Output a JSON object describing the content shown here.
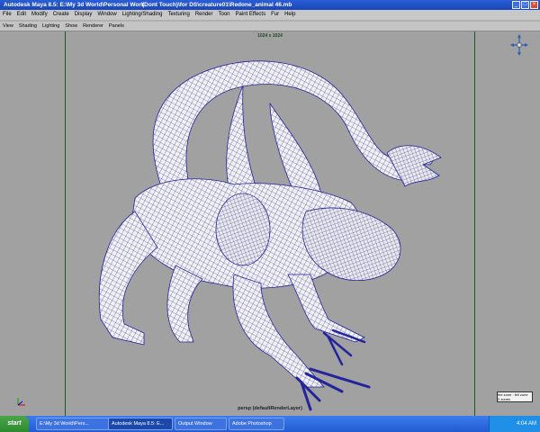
{
  "window": {
    "title": "Autodesk Maya 8.5: E:\\My 3d World\\Personal Work",
    "document": "(Dont Touch)\\for DS\\creature01\\Redone_animal 46.mb"
  },
  "menu": [
    "File",
    "Edit",
    "Modify",
    "Create",
    "Display",
    "Window",
    "Lighting/Shading",
    "Texturing",
    "Render",
    "Toon",
    "Paint Effects",
    "Fur",
    "Help"
  ],
  "panel_menu": [
    "View",
    "Shading",
    "Lighting",
    "Show",
    "Renderer",
    "Panels"
  ],
  "viewport": {
    "resolution_gate": "1024 x 1024",
    "camera_label": "persp (defaultRenderLayer)",
    "corner_box": [
      "fire zone : fell zone",
      "2 zones"
    ]
  },
  "taskbar": {
    "start": "start",
    "items": [
      "E:\\My 3d World\\Pers...",
      "Autodesk Maya 8.5: E...",
      "Output Window",
      "Adobe Photoshop"
    ],
    "clock": "4:04 AM"
  },
  "colors": {
    "title_bar": "#1a47b8",
    "viewport_bg": "#a1a1a1",
    "wire": "#1b1b9a",
    "gate_line": "#1e5a20"
  }
}
